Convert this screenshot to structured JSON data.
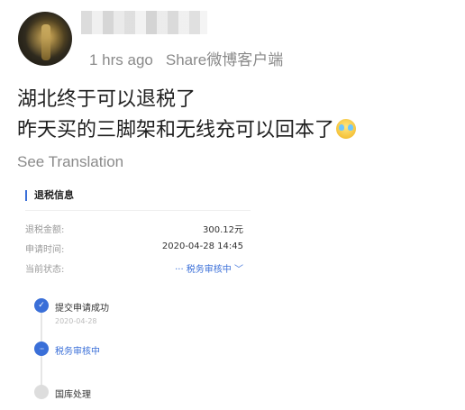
{
  "post": {
    "time_ago": "1 hrs ago",
    "share_source": "Share微博客户端",
    "lines": [
      "湖北终于可以退税了",
      "昨天买的三脚架和无线充可以回本了"
    ],
    "emoji_icon": "crying-laughing-emoji",
    "see_translation": "See Translation"
  },
  "refund_card": {
    "title": "退税信息",
    "rows": [
      {
        "label": "退税金额:",
        "value": "300.12元"
      },
      {
        "label": "申请时间:",
        "value": "2020-04-28 14:45"
      },
      {
        "label": "当前状态:",
        "value": "··· 税务审核中 ﹀"
      }
    ],
    "timeline": [
      {
        "label": "提交申请成功",
        "date": "2020-04-28",
        "status": "done"
      },
      {
        "label": "税务审核中",
        "date": "",
        "status": "active"
      },
      {
        "label": "国库处理",
        "date": "",
        "status": "pending"
      }
    ],
    "colors": {
      "accent": "#3a6fd8",
      "muted": "#9a9a9a"
    }
  }
}
